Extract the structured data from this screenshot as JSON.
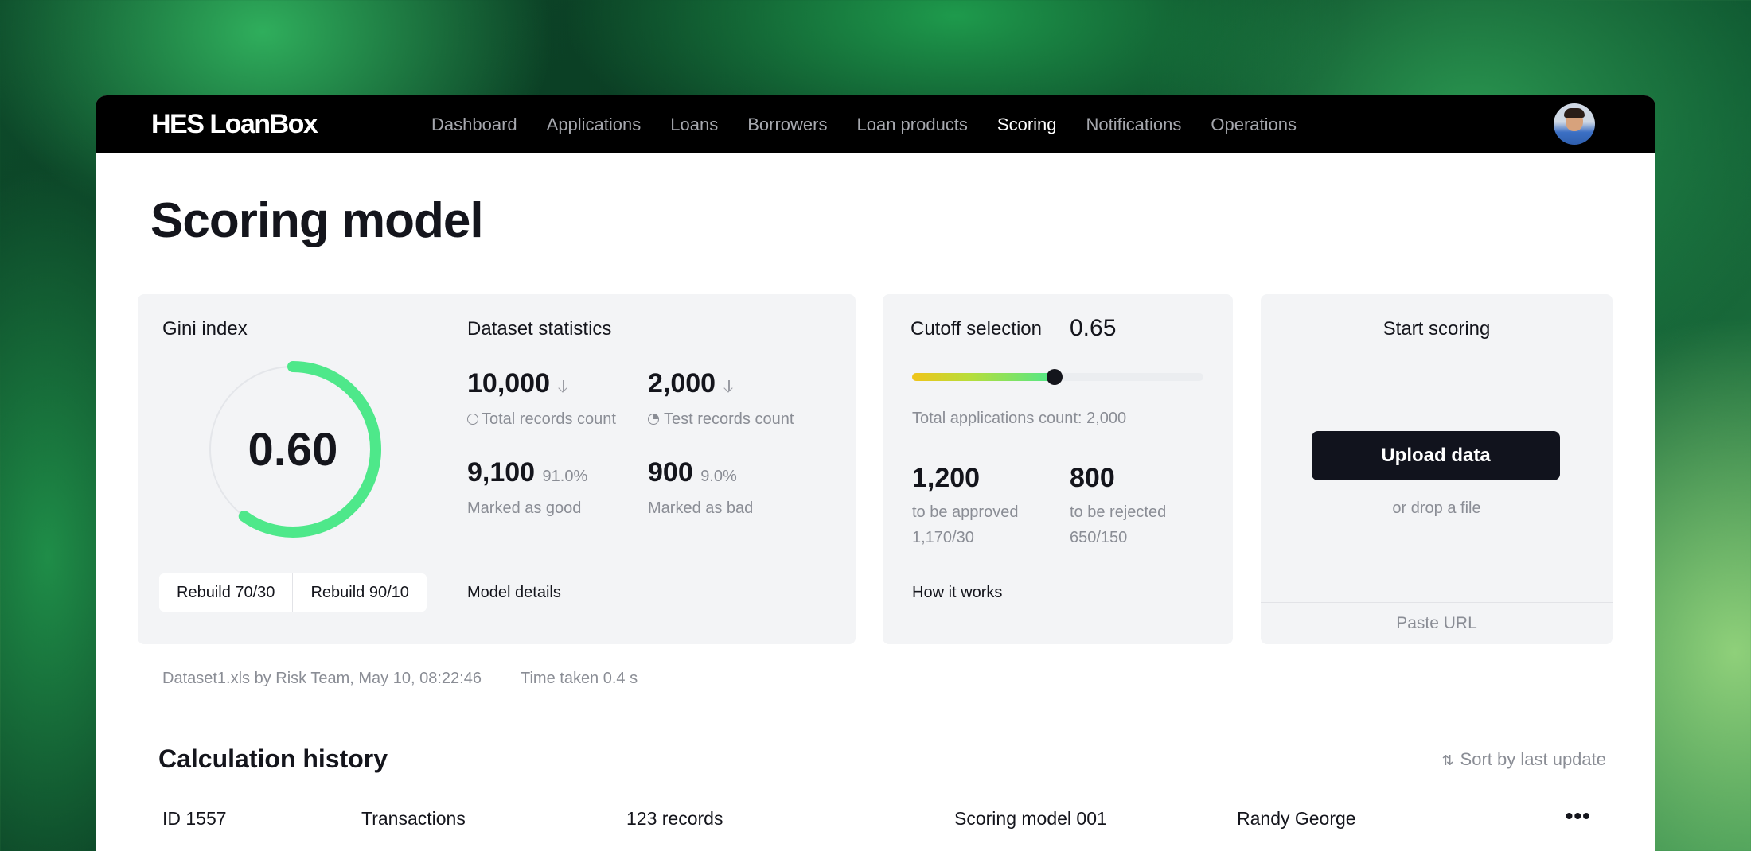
{
  "app": {
    "logo": "HES LoanBox",
    "nav": [
      {
        "label": "Dashboard",
        "active": false
      },
      {
        "label": "Applications",
        "active": false
      },
      {
        "label": "Loans",
        "active": false
      },
      {
        "label": "Borrowers",
        "active": false
      },
      {
        "label": "Loan products",
        "active": false
      },
      {
        "label": "Scoring",
        "active": true
      },
      {
        "label": "Notifications",
        "active": false
      },
      {
        "label": "Operations",
        "active": false
      }
    ]
  },
  "page": {
    "title": "Scoring model"
  },
  "gini": {
    "title": "Gini index",
    "value": "0.60",
    "fraction": 0.6,
    "rebuild_70": "Rebuild 70/30",
    "rebuild_90": "Rebuild 90/10",
    "accent": "#4ee88a"
  },
  "dataset": {
    "title": "Dataset statistics",
    "total_value": "10,000",
    "total_label": "Total records count",
    "test_value": "2,000",
    "test_label": "Test records count",
    "good_value": "9,100",
    "good_pct": "91.0%",
    "good_label": "Marked as good",
    "bad_value": "900",
    "bad_pct": "9.0%",
    "bad_label": "Marked as bad",
    "details_link": "Model details"
  },
  "cutoff": {
    "title": "Cutoff selection",
    "value": "0.65",
    "slider_fraction": 0.49,
    "total_apps": "Total applications count: 2,000",
    "approved_value": "1,200",
    "approved_label": "to be approved",
    "approved_split": "1,170/30",
    "rejected_value": "800",
    "rejected_label": "to be rejected",
    "rejected_split": "650/150",
    "how_link": "How it works"
  },
  "start": {
    "title": "Start scoring",
    "upload": "Upload data",
    "drop": "or drop a file",
    "paste": "Paste URL"
  },
  "meta": {
    "file": "Dataset1.xls by Risk Team, May 10, 08:22:46",
    "time": "Time taken 0.4 s"
  },
  "history": {
    "title": "Calculation history",
    "sort": "Sort by last update",
    "rows": [
      {
        "id": "ID 1557",
        "type": "Transactions",
        "records": "123 records",
        "model": "Scoring model 001",
        "user": "Randy George"
      }
    ]
  }
}
